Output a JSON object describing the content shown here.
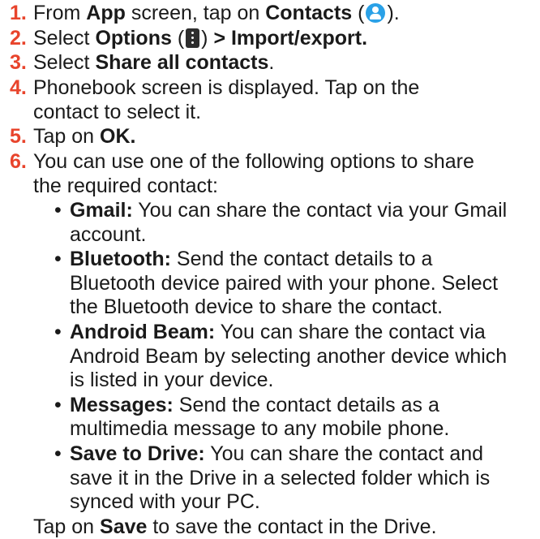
{
  "steps": [
    {
      "num": "1.",
      "pre": "From ",
      "b1": "App",
      "mid": " screen, tap on ",
      "b2": "Contacts",
      "open": " (",
      "icon": "contacts-icon",
      "close": ")."
    },
    {
      "num": "2.",
      "pre": "Select ",
      "b1": "Options",
      "open": " (",
      "icon": "options-menu-icon",
      "close": ") ",
      "b2": "> Import/export."
    },
    {
      "num": "3.",
      "pre": "Select ",
      "b1": "Share all contacts",
      "post": "."
    },
    {
      "num": "4.",
      "line1": "Phonebook screen is displayed. Tap on the",
      "line2": "contact to select it."
    },
    {
      "num": "5.",
      "pre": "Tap on ",
      "b1": "OK."
    },
    {
      "num": "6.",
      "line1": "You can use one of the following options to share",
      "line2": "the required contact:"
    }
  ],
  "options": [
    {
      "title": "Gmail:",
      "line1": " You can share the contact via your Gmail",
      "rest": [
        "account."
      ]
    },
    {
      "title": "Bluetooth:",
      "line1": " Send the contact details to a",
      "rest": [
        "Bluetooth device paired with your phone. Select",
        "the Bluetooth device to share the contact."
      ]
    },
    {
      "title": "Android Beam:",
      "line1": " You can share the contact via",
      "rest": [
        "Android Beam by selecting another device which",
        "is listed in your device."
      ]
    },
    {
      "title": "Messages:",
      "line1": " Send the contact details as a",
      "rest": [
        "multimedia message to any mobile phone."
      ]
    },
    {
      "title": "Save to Drive:",
      "line1": " You can share the contact and",
      "rest": [
        "save it in the Drive in a selected folder which is",
        "synced with your PC."
      ]
    }
  ],
  "bullet": "•",
  "footer": {
    "pre": "Tap on ",
    "bold": "Save",
    "post": " to save the contact in the Drive."
  },
  "colors": {
    "step_number": "#e8442c",
    "contacts_icon": "#2aa1e7"
  }
}
